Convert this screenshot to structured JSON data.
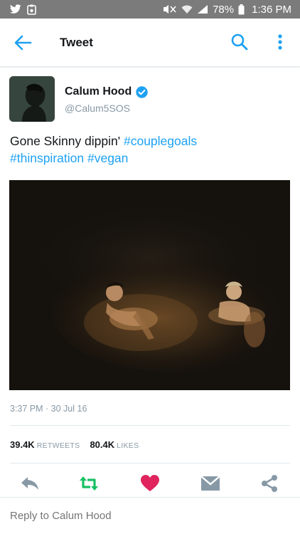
{
  "status_bar": {
    "left_icons": [
      "twitter-bird-icon",
      "clipboard-icon"
    ],
    "right_icons": [
      "mute-icon",
      "wifi-icon",
      "signal-icon",
      "battery-icon"
    ],
    "battery": "78%",
    "time": "1:36 PM"
  },
  "app_bar": {
    "title": "Tweet",
    "icons": [
      "back-arrow-icon",
      "search-icon",
      "more-vertical-icon"
    ]
  },
  "tweet": {
    "author_name": "Calum Hood",
    "author_handle": "@Calum5SOS",
    "verified": true,
    "text_plain": "Gone Skinny dippin'",
    "hashtag_1": "#couplegoals",
    "hashtag_2": "#thinspiration",
    "hashtag_3": "#vegan",
    "timestamp": "3:37 PM · 30 Jul 16",
    "retweets_count": "39.4K",
    "retweets_label": "RETWEETS",
    "likes_count": "80.4K",
    "likes_label": "LIKES"
  },
  "actions": [
    "reply-icon",
    "retweet-icon",
    "like-icon",
    "direct-message-icon",
    "share-icon"
  ],
  "reply_box": {
    "placeholder": "Reply to Calum Hood"
  },
  "colors": {
    "status_bar_bg": "#7b7b7b",
    "accent_blue": "#1da1f2",
    "verified_blue": "#1da1f2",
    "retweet_green": "#17bf63",
    "like_red": "#e0245e",
    "muted_text": "#8899a6",
    "action_icon_gray": "#8899a6"
  }
}
